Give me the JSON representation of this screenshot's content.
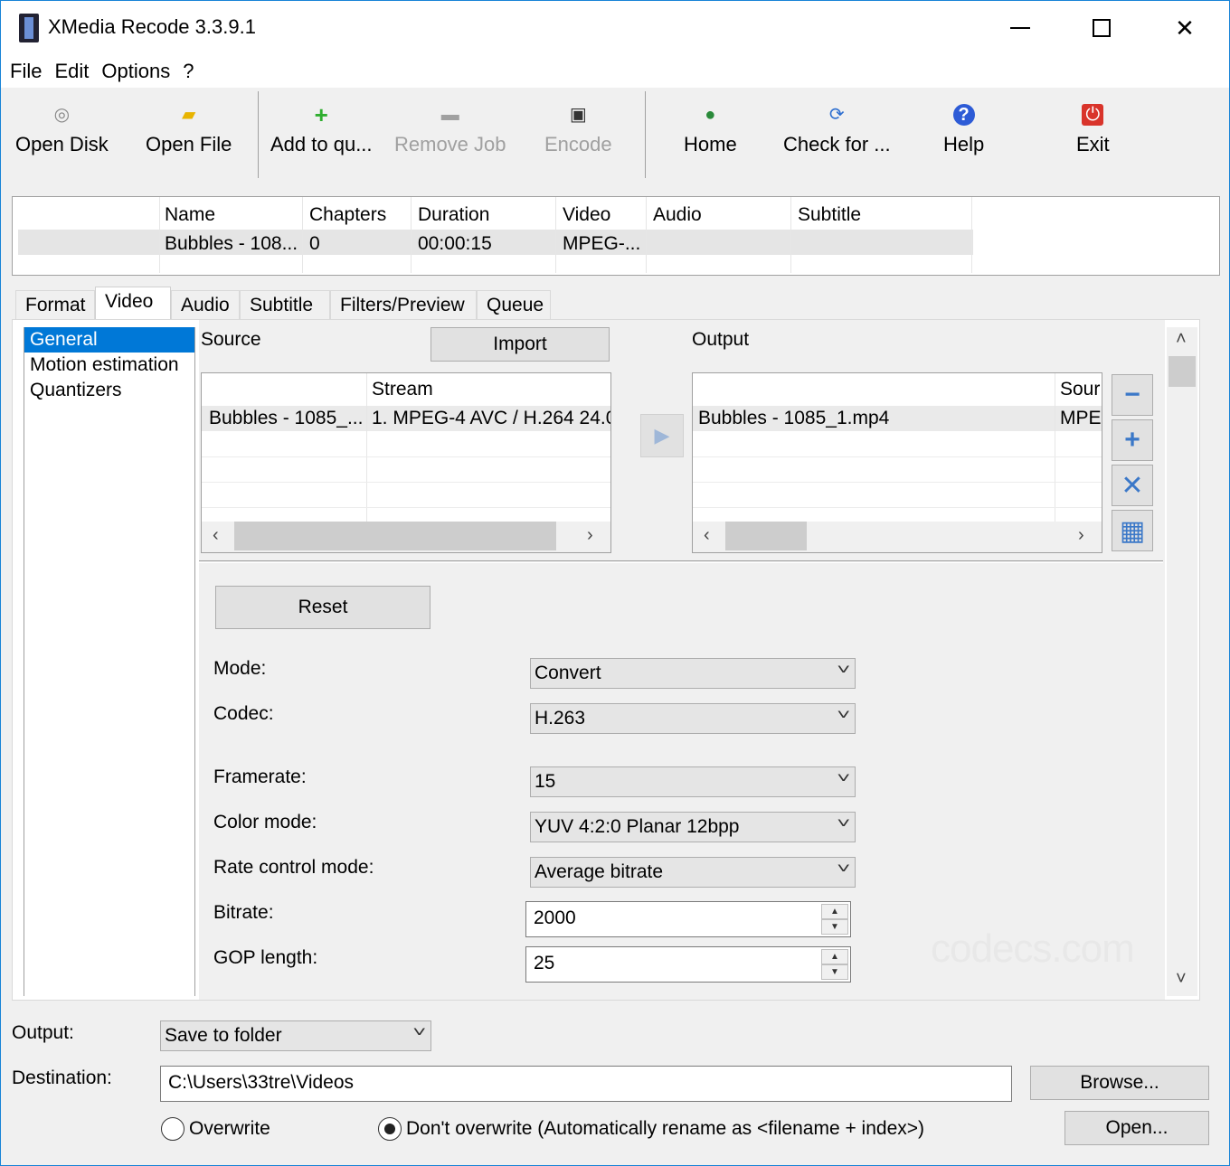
{
  "window": {
    "title": "XMedia Recode 3.3.9.1",
    "minimize": "—",
    "maximize": "□",
    "close": "✕"
  },
  "menu": [
    "File",
    "Edit",
    "Options",
    "?"
  ],
  "toolbar": {
    "open_disk": "Open Disk",
    "open_file": "Open File",
    "add_to_queue": "Add to qu...",
    "remove_job": "Remove Job",
    "encode": "Encode",
    "home": "Home",
    "check_for": "Check for ...",
    "help": "Help",
    "exit": "Exit",
    "icons": {
      "open_disk": "disc-icon",
      "open_file": "folder-icon",
      "add_to_queue": "plus-icon",
      "remove_job": "minus-icon",
      "encode": "encode-icon",
      "home": "globe-icon",
      "check_for": "refresh-icon",
      "help": "help-icon",
      "exit": "power-icon"
    }
  },
  "joblist": {
    "headers": [
      "Name",
      "Chapters",
      "Duration",
      "Video",
      "Audio",
      "Subtitle"
    ],
    "row": {
      "name": "Bubbles - 108...",
      "chapters": "0",
      "duration": "00:00:15",
      "video": "MPEG-...",
      "audio": "",
      "subtitle": ""
    }
  },
  "tabs": [
    "Format",
    "Video",
    "Audio",
    "Subtitle",
    "Filters/Preview",
    "Queue"
  ],
  "active_tab": "Video",
  "leftnav": [
    "General",
    "Motion estimation",
    "Quantizers"
  ],
  "source": {
    "label": "Source",
    "import": "Import",
    "header_stream": "Stream",
    "row_name": "Bubbles - 1085_...",
    "row_stream": "1. MPEG-4 AVC / H.264 24.0"
  },
  "output": {
    "label": "Output",
    "header_source": "Sour",
    "row_name": "Bubbles - 1085_1.mp4",
    "row_source": "MPE("
  },
  "scroll_arrows": {
    "left": "‹",
    "right": "›",
    "up": "˄",
    "down": "˅"
  },
  "side_buttons": {
    "remove": "−",
    "add": "+",
    "delete": "✕",
    "calc": "▦"
  },
  "reset": "Reset",
  "settings": {
    "mode_label": "Mode:",
    "mode_value": "Convert",
    "codec_label": "Codec:",
    "codec_value": "H.263",
    "framerate_label": "Framerate:",
    "framerate_value": "15",
    "color_label": "Color mode:",
    "color_value": "YUV 4:2:0 Planar 12bpp",
    "rate_label": "Rate control mode:",
    "rate_value": "Average bitrate",
    "bitrate_label": "Bitrate:",
    "bitrate_value": "2000",
    "gop_label": "GOP length:",
    "gop_value": "25"
  },
  "watermark": "codecs.com",
  "bottom": {
    "output_label": "Output:",
    "output_value": "Save to folder",
    "destination_label": "Destination:",
    "destination_value": "C:\\Users\\33tre\\Videos",
    "browse": "Browse...",
    "overwrite": "Overwrite",
    "dont_overwrite": "Don't overwrite (Automatically rename as <filename + index>)",
    "open": "Open..."
  }
}
